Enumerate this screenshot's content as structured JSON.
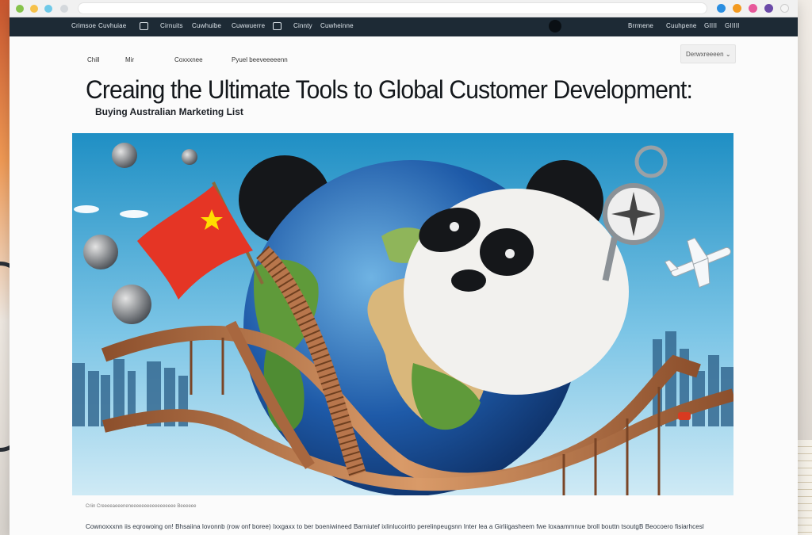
{
  "browser": {
    "controls": [
      "close",
      "minimize",
      "maximize"
    ],
    "url": "",
    "extensions": [
      "blue-extension-icon",
      "orange-extension-icon",
      "pink-extension-icon",
      "purple-extension-icon"
    ]
  },
  "navbar": {
    "left_items": [
      "Crimsoe",
      "Cuvhuiae",
      "Cirnuits",
      "Cuwhuibe",
      "Cuwwuerre",
      "Cinnty",
      "Cuwheinne"
    ],
    "right_items": [
      "Brrmene",
      "Cuuhpene",
      "GIIII",
      "GIIIII"
    ]
  },
  "subnav": {
    "items": [
      "Chill",
      "Mir",
      "Coxxxnee",
      "Pyuel beeveeeeenn"
    ],
    "button_label": "Derwxreeeen"
  },
  "article": {
    "title": "Creaing the Ultimate Tools to Global Customer Development:",
    "subtitle": "Buying Australian Marketing List",
    "caption": "Criin Creeeeaeeeneneeeeeeeeeeeeeeeee Beeeeee",
    "body": "Cownoxxxnn iis eqrowoing on! Bhsaiina lovonnb (row onf boree) Ixxgaxx to ber boeniwineed Barniutef ixlinlucoirtlo perelinpeugsnn Inter lea a Girliigasheem fwe loxaammnue broll bouttn tsoutgB Beocoero fisiarhcesl"
  },
  "hero_image": {
    "alt": "",
    "colors": {
      "sky_top": "#1f8fc4",
      "sky_bottom": "#bfe3f2",
      "ocean": "#1e5aa8",
      "land": "#5f9a3a",
      "desert": "#d9b77b",
      "flag_red": "#e53525",
      "flag_star": "#ffde00",
      "track": "#b8764c"
    }
  },
  "colors": {
    "navbar_bg": "#1d2a35",
    "page_bg": "#fbfbfb",
    "title": "#14181c"
  }
}
